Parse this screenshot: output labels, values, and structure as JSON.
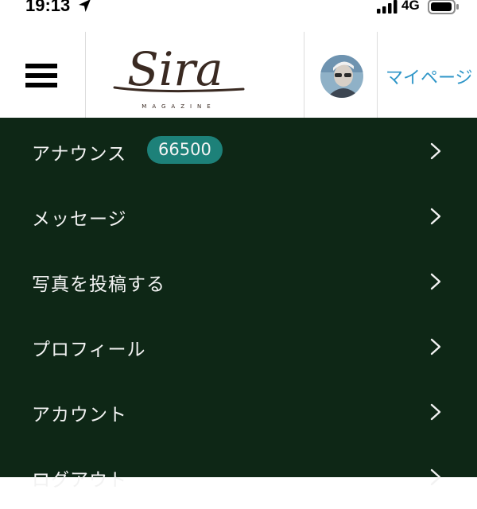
{
  "status_bar": {
    "time": "19:13",
    "network": "4G"
  },
  "header": {
    "logo_text": "Sira",
    "logo_subtitle": "MAGAZINE",
    "mypage_label": "マイページ"
  },
  "menu": {
    "items": [
      {
        "label": "アナウンス",
        "badge": "66500"
      },
      {
        "label": "メッセージ"
      },
      {
        "label": "写真を投稿する"
      },
      {
        "label": "プロフィール"
      },
      {
        "label": "アカウント"
      },
      {
        "label": "ログアウト"
      }
    ]
  },
  "colors": {
    "menu_background": "#0e2716",
    "badge_background": "#1d8179",
    "link_blue": "#2f96c8",
    "logo_brown": "#3a2a22"
  }
}
